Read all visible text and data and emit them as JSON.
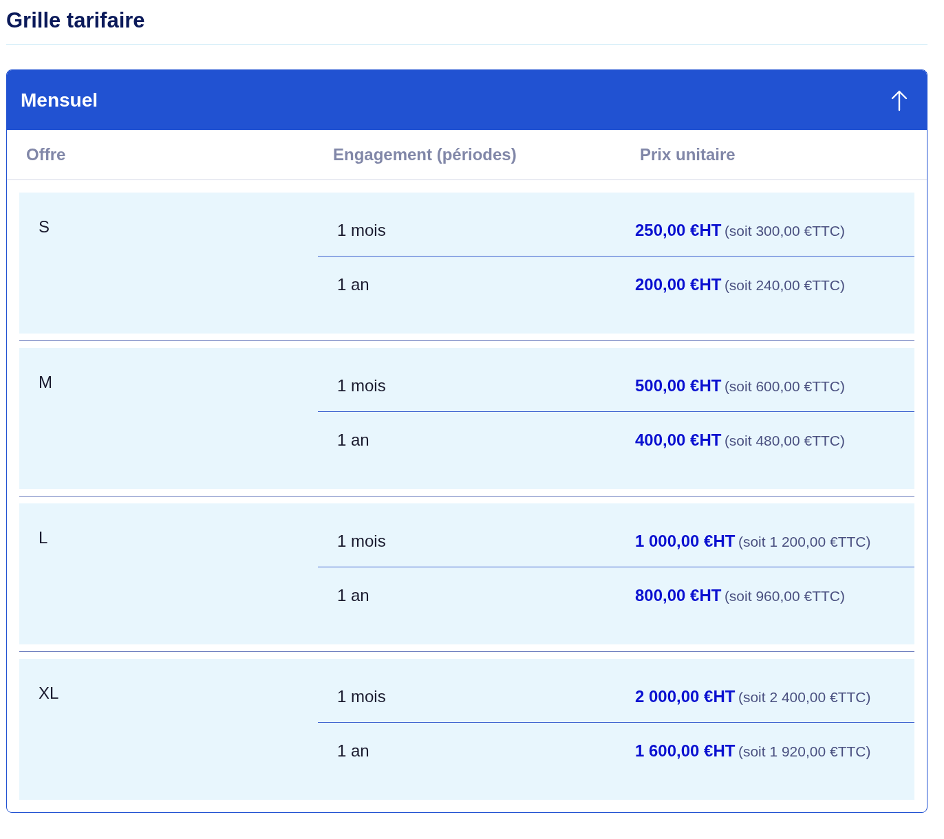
{
  "title": "Grille tarifaire",
  "panel": {
    "title": "Mensuel",
    "expanded": true
  },
  "columns": [
    "Offre",
    "Engagement (périodes)",
    "Prix unitaire"
  ],
  "offers": [
    {
      "name": "S",
      "rows": [
        {
          "engagement": "1 mois",
          "price_ht": "250,00 €HT",
          "price_ttc": "(soit 300,00 €TTC)"
        },
        {
          "engagement": "1 an",
          "price_ht": "200,00 €HT",
          "price_ttc": "(soit 240,00 €TTC)"
        }
      ]
    },
    {
      "name": "M",
      "rows": [
        {
          "engagement": "1 mois",
          "price_ht": "500,00 €HT",
          "price_ttc": "(soit 600,00 €TTC)"
        },
        {
          "engagement": "1 an",
          "price_ht": "400,00 €HT",
          "price_ttc": "(soit 480,00 €TTC)"
        }
      ]
    },
    {
      "name": "L",
      "rows": [
        {
          "engagement": "1 mois",
          "price_ht": "1 000,00 €HT",
          "price_ttc": "(soit 1 200,00 €TTC)"
        },
        {
          "engagement": "1 an",
          "price_ht": "800,00 €HT",
          "price_ttc": "(soit 960,00 €TTC)"
        }
      ]
    },
    {
      "name": "XL",
      "rows": [
        {
          "engagement": "1 mois",
          "price_ht": "2 000,00 €HT",
          "price_ttc": "(soit 2 400,00 €TTC)"
        },
        {
          "engagement": "1 an",
          "price_ht": "1 600,00 €HT",
          "price_ttc": "(soit 1 920,00 €TTC)"
        }
      ]
    }
  ]
}
